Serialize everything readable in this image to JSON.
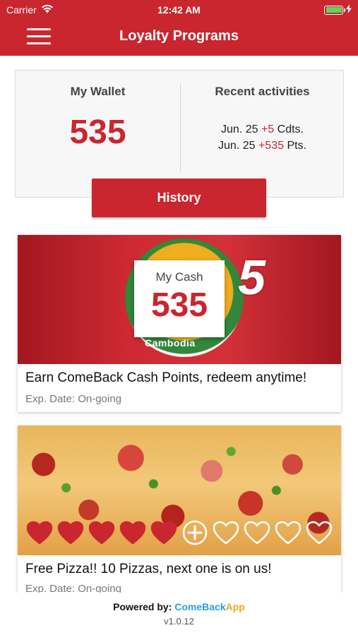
{
  "status_bar": {
    "carrier": "Carrier",
    "time": "12:42 AM",
    "battery_color": "#5bd75b"
  },
  "nav": {
    "title": "Loyalty Programs",
    "menu_icon": "hamburger-menu-icon"
  },
  "wallet": {
    "title": "My Wallet",
    "value": "535",
    "recent_title": "Recent activities",
    "activities": [
      {
        "date": "Jun. 25",
        "amount": "+5",
        "unit": "Cdts."
      },
      {
        "date": "Jun. 25",
        "amount": "+535",
        "unit": "Pts."
      }
    ]
  },
  "history_button": "History",
  "promos": [
    {
      "cash_label": "My Cash",
      "cash_value": "535",
      "logo_five": "5",
      "logo_word": "Cambodia",
      "title": "Earn ComeBack Cash Points, redeem anytime!",
      "exp": "Exp. Date: On-going"
    },
    {
      "title": "Free Pizza!! 10 Pizzas, next one is on us!",
      "exp": "Exp. Date: On-going",
      "stamps_filled": 5,
      "stamps_total": 10
    }
  ],
  "footer": {
    "powered_by": "Powered by:",
    "brand_part1": "ComeBack",
    "brand_part2": "App",
    "version": "v1.0.12"
  },
  "colors": {
    "brand_red": "#c9262f",
    "brand_blue": "#2a9de0",
    "brand_orange": "#f0a81c"
  }
}
